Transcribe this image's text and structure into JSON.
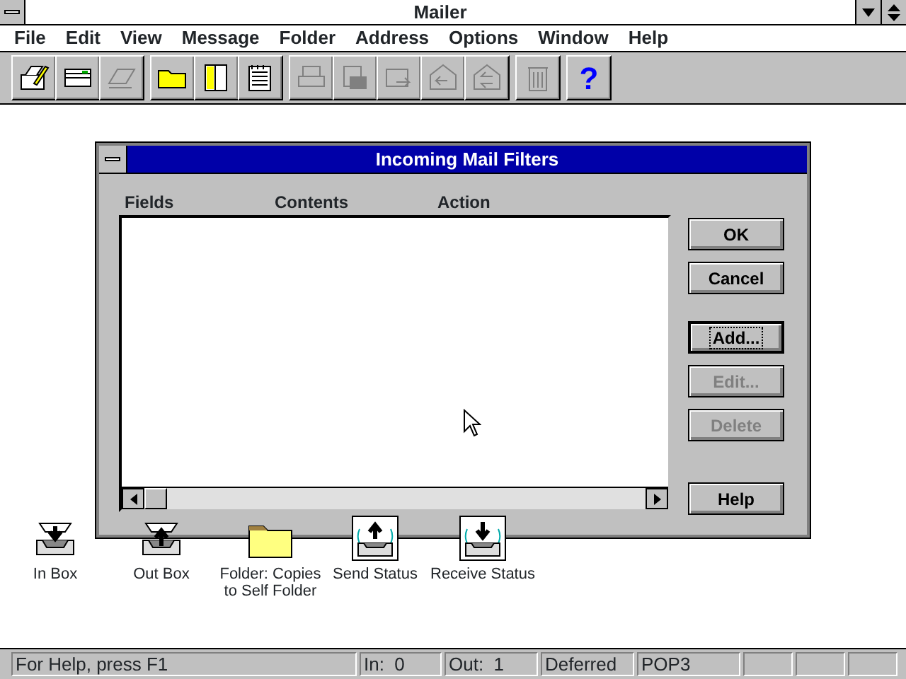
{
  "window": {
    "title": "Mailer"
  },
  "menu": [
    {
      "label": "File"
    },
    {
      "label": "Edit"
    },
    {
      "label": "View"
    },
    {
      "label": "Message"
    },
    {
      "label": "Folder"
    },
    {
      "label": "Address"
    },
    {
      "label": "Options"
    },
    {
      "label": "Window"
    },
    {
      "label": "Help"
    }
  ],
  "toolbar": [
    [
      {
        "kind": "compose",
        "disabled": false
      },
      {
        "kind": "read",
        "disabled": false
      },
      {
        "kind": "envelope",
        "disabled": true
      }
    ],
    [
      {
        "kind": "folder",
        "disabled": false
      },
      {
        "kind": "addressbook",
        "disabled": false
      },
      {
        "kind": "notepad",
        "disabled": false
      }
    ],
    [
      {
        "kind": "print",
        "disabled": true
      },
      {
        "kind": "save",
        "disabled": true
      },
      {
        "kind": "forward",
        "disabled": true
      },
      {
        "kind": "reply",
        "disabled": true
      },
      {
        "kind": "replyall",
        "disabled": true
      }
    ],
    [
      {
        "kind": "trash",
        "disabled": true
      }
    ],
    [
      {
        "kind": "help",
        "label": "?",
        "disabled": false
      }
    ]
  ],
  "dialog": {
    "title": "Incoming Mail Filters",
    "columns": [
      "Fields",
      "Contents",
      "Action"
    ],
    "buttons": [
      {
        "label": "OK",
        "disabled": false,
        "focused": false
      },
      {
        "label": "Cancel",
        "disabled": false,
        "focused": false
      },
      {
        "label": "Add...",
        "disabled": false,
        "focused": true
      },
      {
        "label": "Edit...",
        "disabled": true,
        "focused": false
      },
      {
        "label": "Delete",
        "disabled": true,
        "focused": false
      },
      {
        "label": "Help",
        "disabled": false,
        "focused": false
      }
    ]
  },
  "desktop_icons": [
    {
      "kind": "inbox",
      "label": "In Box"
    },
    {
      "kind": "outbox",
      "label": "Out Box"
    },
    {
      "kind": "folder",
      "label": "Folder: Copies to Self Folder"
    },
    {
      "kind": "send",
      "label": "Send Status"
    },
    {
      "kind": "receive",
      "label": "Receive Status"
    }
  ],
  "status_bar": [
    "For Help, press F1",
    "In:  0",
    "Out:  1",
    "Deferred",
    "POP3"
  ]
}
